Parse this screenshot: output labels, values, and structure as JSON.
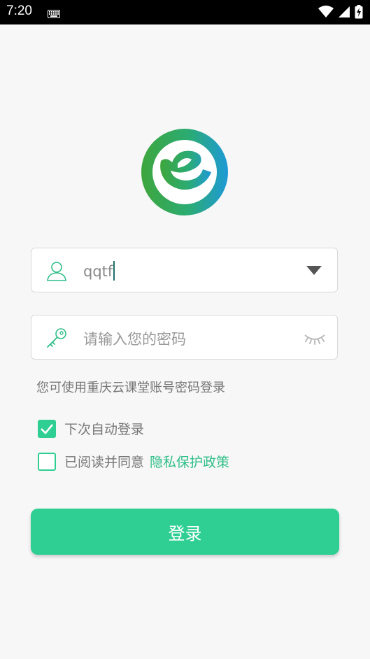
{
  "status_bar": {
    "time": "7:20"
  },
  "login": {
    "username_value": "qqtf",
    "password_placeholder": "请输入您的密码",
    "hint": "您可使用重庆云课堂账号密码登录",
    "auto_login_label": "下次自动登录",
    "agree_label": "已阅读并同意",
    "privacy_link": "隐私保护政策",
    "login_button": "登录"
  },
  "colors": {
    "accent": "#2fcf93",
    "link": "#2fbf88"
  }
}
